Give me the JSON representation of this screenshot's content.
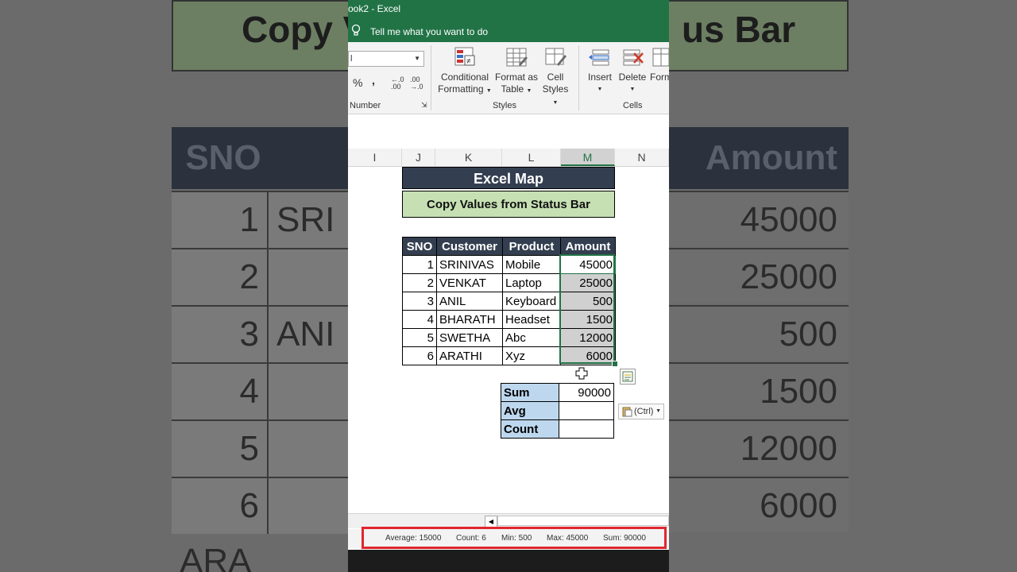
{
  "window": {
    "title": "ook2  -  Excel",
    "tell_me": "Tell me what you want to do"
  },
  "ribbon": {
    "number_format_value": "l",
    "percent": "%",
    "comma": ",",
    "inc_decimal": "←.0 .00",
    "dec_decimal": ".00 →.0",
    "number_group": "Number",
    "conditional_formatting": [
      "Conditional",
      "Formatting"
    ],
    "format_as_table": [
      "Format as",
      "Table"
    ],
    "cell_styles": [
      "Cell",
      "Styles"
    ],
    "styles_group": "Styles",
    "insert": "Insert",
    "delete": "Delete",
    "format": "Form",
    "cells_group": "Cells"
  },
  "columns": [
    "I",
    "J",
    "K",
    "L",
    "M",
    "N"
  ],
  "sheet": {
    "title": "Excel Map",
    "subtitle": "Copy Values from Status Bar",
    "headers": [
      "SNO",
      "Customer",
      "Product",
      "Amount"
    ],
    "rows": [
      {
        "sno": "1",
        "customer": "SRINIVAS",
        "product": "Mobile",
        "amount": "45000"
      },
      {
        "sno": "2",
        "customer": "VENKAT",
        "product": "Laptop",
        "amount": "25000"
      },
      {
        "sno": "3",
        "customer": "ANIL",
        "product": "Keyboard",
        "amount": "500"
      },
      {
        "sno": "4",
        "customer": "BHARATH",
        "product": "Headset",
        "amount": "1500"
      },
      {
        "sno": "5",
        "customer": "SWETHA",
        "product": "Abc",
        "amount": "12000"
      },
      {
        "sno": "6",
        "customer": "ARATHI",
        "product": "Xyz",
        "amount": "6000"
      }
    ],
    "summary": [
      {
        "label": "Sum",
        "value": "90000"
      },
      {
        "label": "Avg",
        "value": ""
      },
      {
        "label": "Count",
        "value": ""
      }
    ],
    "paste_options": "(Ctrl)"
  },
  "status_bar": {
    "average": "Average: 15000",
    "count": "Count: 6",
    "min": "Min: 500",
    "max": "Max: 45000",
    "sum": "Sum: 90000"
  },
  "colors": {
    "excel_green": "#217346",
    "header_navy": "#333f50",
    "title_green": "#c6e0b4",
    "summary_blue": "#bdd7ee",
    "highlight_red": "#e0262e"
  }
}
